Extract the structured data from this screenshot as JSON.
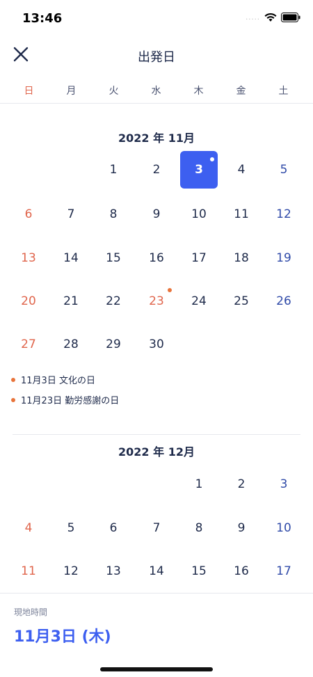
{
  "status": {
    "time": "13:46",
    "signal": "....."
  },
  "header": {
    "title": "出発日"
  },
  "weekdays": [
    "日",
    "月",
    "火",
    "水",
    "木",
    "金",
    "土"
  ],
  "november": {
    "title": "2022 年 11月",
    "days": [
      "1",
      "2",
      "3",
      "4",
      "5",
      "6",
      "7",
      "8",
      "9",
      "10",
      "11",
      "12",
      "13",
      "14",
      "15",
      "16",
      "17",
      "18",
      "19",
      "20",
      "21",
      "22",
      "23",
      "24",
      "25",
      "26",
      "27",
      "28",
      "29",
      "30"
    ],
    "holidays": [
      "11月3日  文化の日",
      "11月23日  勤労感謝の日"
    ]
  },
  "december": {
    "title": "2022 年 12月",
    "days": [
      "1",
      "2",
      "3",
      "4",
      "5",
      "6",
      "7",
      "8",
      "9",
      "10",
      "11",
      "12",
      "13",
      "14",
      "15",
      "16",
      "17"
    ]
  },
  "footer": {
    "label": "現地時間",
    "selected_date": "11月3日 (木)"
  },
  "colors": {
    "accent": "#3d5ff0",
    "sunday": "#e0654c",
    "saturday": "#2f4aa8",
    "holiday_dot": "#e8743b"
  }
}
